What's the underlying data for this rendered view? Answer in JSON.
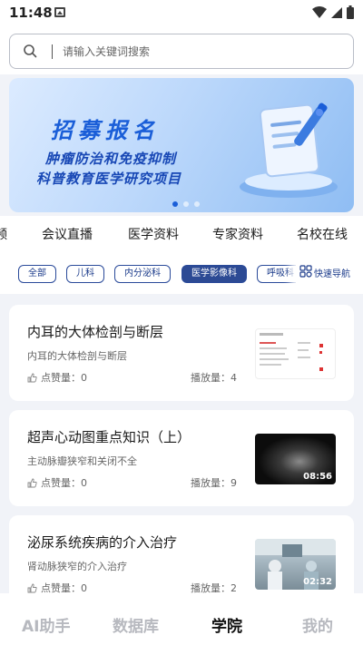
{
  "status_bar": {
    "time": "11:48"
  },
  "search": {
    "placeholder": "请输入关键词搜索"
  },
  "banner": {
    "title": "招募报名",
    "line1": "肿瘤防治和免疫抑制",
    "line2": "科普教育医学研究项目",
    "dots": 3,
    "active_dot": 0
  },
  "category_tabs": [
    "频",
    "会议直播",
    "医学资料",
    "专家资料",
    "名校在线"
  ],
  "filter_chips": [
    {
      "label": "全部",
      "active": false
    },
    {
      "label": "儿科",
      "active": false
    },
    {
      "label": "内分泌科",
      "active": false
    },
    {
      "label": "医学影像科",
      "active": true
    },
    {
      "label": "呼吸科",
      "active": false
    }
  ],
  "quick_nav": {
    "label": "快速导航"
  },
  "cards": [
    {
      "title": "内耳的大体检剖与断层",
      "subtitle": "内耳的大体检剖与断层",
      "likes": "点赞量：0",
      "plays": "播放量：4",
      "thumb": "document",
      "duration": ""
    },
    {
      "title": "超声心动图重点知识（上）",
      "subtitle": "主动脉瓣狭窄和关闭不全",
      "likes": "点赞量：0",
      "plays": "播放量：9",
      "thumb": "ultrasound",
      "duration": "08:56"
    },
    {
      "title": "泌尿系统疾病的介入治疗",
      "subtitle": "肾动脉狭窄的介入治疗",
      "likes": "点赞量：0",
      "plays": "播放量：2",
      "thumb": "clinic",
      "duration": "02:32"
    }
  ],
  "bottom_nav": [
    {
      "label": "AI助手",
      "active": false
    },
    {
      "label": "数据库",
      "active": false
    },
    {
      "label": "学院",
      "active": true
    },
    {
      "label": "我的",
      "active": false
    }
  ],
  "colors": {
    "accent": "#2c4a94",
    "banner_text": "#1747b5",
    "nav_inactive": "#b7b9bf"
  }
}
